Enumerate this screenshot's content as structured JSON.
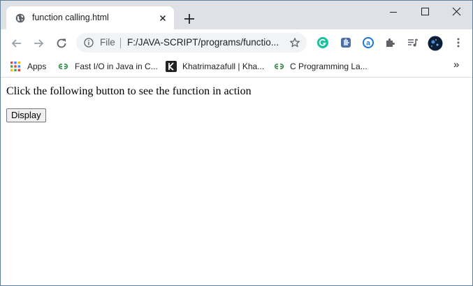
{
  "tab": {
    "title": "function calling.html"
  },
  "toolbar": {
    "scheme_label": "File",
    "url": "F:/JAVA-SCRIPT/programs/functio..."
  },
  "bookmarks": {
    "items": [
      {
        "label": "Apps",
        "icon": "apps-grid-icon"
      },
      {
        "label": "Fast I/O in Java in C...",
        "icon": "geeksforgeeks-icon"
      },
      {
        "label": "Khatrimazafull | Kha...",
        "icon": "k-logo-icon"
      },
      {
        "label": "C Programming La...",
        "icon": "geeksforgeeks-icon"
      }
    ],
    "overflow_label": "»"
  },
  "page": {
    "paragraph": "Click the following button to see the function in action",
    "button_label": "Display"
  },
  "colors": {
    "titlebar": "#dee1e6",
    "grammarly": "#15c39a",
    "gfg": "#2f8d46",
    "extension_blue": "#4a6fa5"
  }
}
